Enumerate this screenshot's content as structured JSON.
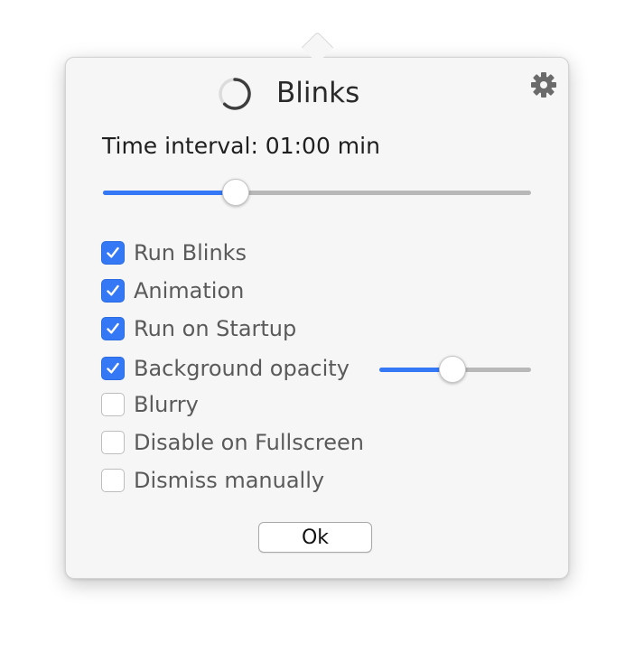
{
  "app": {
    "title": "Blinks",
    "settings_icon": "gear-icon",
    "spinner_icon": "progress-ring-icon"
  },
  "interval": {
    "label": "Time interval: 01:00 min",
    "slider_fraction": 0.31
  },
  "options": [
    {
      "label": "Run Blinks",
      "checked": true
    },
    {
      "label": "Animation",
      "checked": true
    },
    {
      "label": "Run on Startup",
      "checked": true
    },
    {
      "label": "Background opacity",
      "checked": true
    },
    {
      "label": "Blurry",
      "checked": false
    },
    {
      "label": "Disable on Fullscreen",
      "checked": false
    },
    {
      "label": "Dismiss manually",
      "checked": false
    }
  ],
  "opacity": {
    "slider_fraction": 0.48
  },
  "buttons": {
    "ok_label": "Ok"
  },
  "colors": {
    "accent": "#3478f6",
    "track": "#b8b8b8",
    "background": "#f6f6f6"
  }
}
